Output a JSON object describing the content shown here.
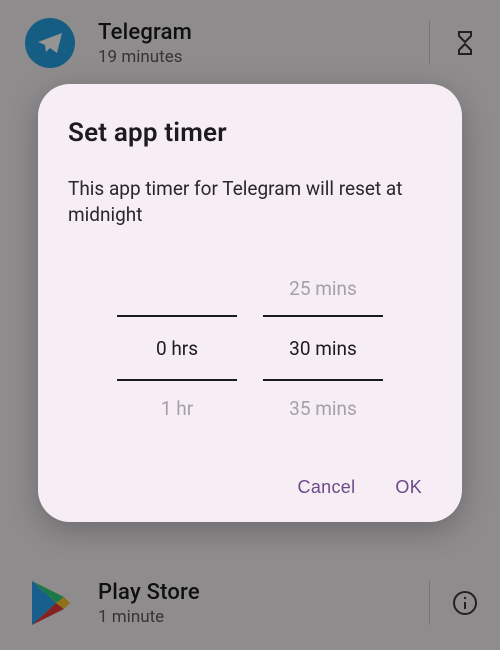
{
  "background": {
    "rows": [
      {
        "name": "Telegram",
        "usage": "19 minutes",
        "trailing_icon": "hourglass-icon"
      },
      {
        "name": "Play Store",
        "usage": "1 minute",
        "trailing_icon": "info-icon"
      }
    ]
  },
  "dialog": {
    "title": "Set app timer",
    "body": "This app timer for Telegram will reset at midnight",
    "picker": {
      "hours": {
        "prev": "",
        "current": "0 hrs",
        "next": "1 hr"
      },
      "minutes": {
        "prev": "25 mins",
        "current": "30 mins",
        "next": "35 mins"
      }
    },
    "actions": {
      "cancel": "Cancel",
      "ok": "OK"
    },
    "accent_color": "#6b4a8a"
  }
}
